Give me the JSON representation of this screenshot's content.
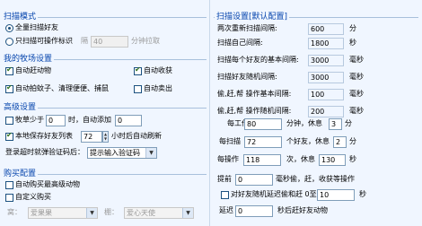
{
  "scan_mode": {
    "title": "扫描模式",
    "option_all": "全量扫描好友",
    "option_partial": "只扫描可操作标识",
    "interval_label": "隔",
    "interval_value": "40",
    "interval_unit": "分钟拉取"
  },
  "ranch": {
    "title": "我的牧场设置",
    "items": [
      {
        "label": "自动赶动物",
        "checked": true
      },
      {
        "label": "自动收获",
        "checked": true
      },
      {
        "label": "自动拍蚊子、清理便便、捕鼠",
        "checked": true
      },
      {
        "label": "自动卖出",
        "checked": false
      }
    ]
  },
  "advanced": {
    "title": "高级设置",
    "feed_label": "牧草少于",
    "feed_value": "0",
    "feed_mid": "时，自动添加",
    "feed_add": "0",
    "local_label": "本地保存好友列表",
    "local_value": "72",
    "local_unit": "小时后自动刷新",
    "captcha_label": "登录超时就弹验证码后：",
    "captcha_option": "提示输入验证码"
  },
  "purchase": {
    "title": "购买配置",
    "auto_buy": "自动购买最高级动物",
    "custom_buy": "自定义购买",
    "nest_label": "窝：",
    "nest_value": "爱果果",
    "shed_label": "棚：",
    "shed_value": "爱心天使"
  },
  "scan_settings": {
    "title": "扫描设置[默认配置]",
    "rows": [
      {
        "label": "两次重新扫描间隔:",
        "value": "600",
        "unit": "分"
      },
      {
        "label": "扫描自己间隔:",
        "value": "1800",
        "unit": "秒"
      },
      {
        "label": "扫描每个好友的基本间隔:",
        "value": "3000",
        "unit": "毫秒"
      },
      {
        "label": "扫描好友随机间隔:",
        "value": "3000",
        "unit": "毫秒"
      },
      {
        "label": "偷,赶,帮 操作基本间隔:",
        "value": "100",
        "unit": "毫秒"
      },
      {
        "label": "偷,赶,帮 操作随机间隔:",
        "value": "200",
        "unit": "毫秒"
      }
    ],
    "work_label": "每工作",
    "work_value": "80",
    "work_unit": "分钟，休息",
    "work_rest": "3",
    "work_rest_unit": "分",
    "scan_every_label": "每扫描",
    "scan_every_value": "72",
    "scan_every_unit": "个好友，休息",
    "scan_rest": "2",
    "scan_rest_unit": "分",
    "op_label": "每操作",
    "op_value": "118",
    "op_unit": "次，休息",
    "op_rest": "130",
    "op_rest_unit": "秒",
    "early_label": "提前",
    "early_value": "0",
    "early_unit": "毫秒偷，赶，收获等操作",
    "random_label": "对好友随机延迟偷和赶 0至",
    "random_value": "10",
    "random_unit": "秒",
    "delay_label": "延迟",
    "delay_value": "0",
    "delay_unit": "秒后赶好友动物"
  }
}
